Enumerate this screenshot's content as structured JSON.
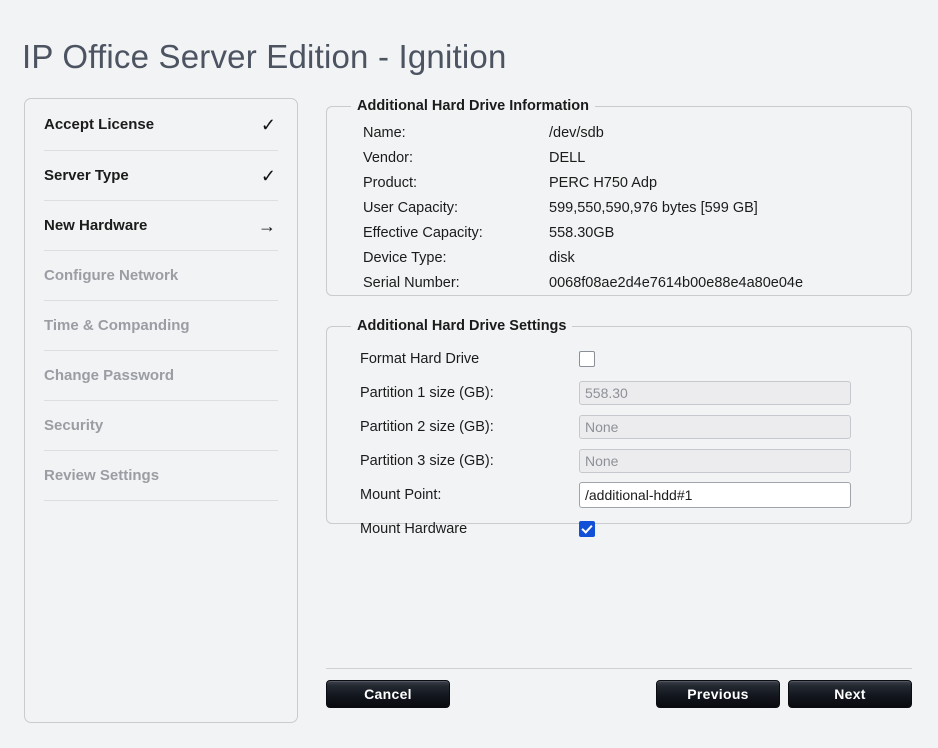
{
  "window": {
    "title": "IP Office Server Edition - Ignition"
  },
  "sidebar": {
    "items": [
      {
        "label": "Accept License",
        "state": "done",
        "mark": "✓"
      },
      {
        "label": "Server Type",
        "state": "done",
        "mark": "✓"
      },
      {
        "label": "New Hardware",
        "state": "current",
        "mark": "→"
      },
      {
        "label": "Configure Network",
        "state": "pending",
        "mark": ""
      },
      {
        "label": "Time & Companding",
        "state": "pending",
        "mark": ""
      },
      {
        "label": "Change Password",
        "state": "pending",
        "mark": ""
      },
      {
        "label": "Security",
        "state": "pending",
        "mark": ""
      },
      {
        "label": "Review Settings",
        "state": "pending",
        "mark": ""
      }
    ]
  },
  "info_panel": {
    "legend": "Additional Hard Drive Information",
    "rows": [
      {
        "label": "Name:",
        "value": "/dev/sdb"
      },
      {
        "label": "Vendor:",
        "value": "DELL"
      },
      {
        "label": "Product:",
        "value": "PERC H750 Adp"
      },
      {
        "label": "User Capacity:",
        "value": "599,550,590,976 bytes [599 GB]"
      },
      {
        "label": "Effective Capacity:",
        "value": "558.30GB"
      },
      {
        "label": "Device Type:",
        "value": "disk"
      },
      {
        "label": "Serial Number:",
        "value": "0068f08ae2d4e7614b00e88e4a80e04e"
      }
    ]
  },
  "settings_panel": {
    "legend": "Additional Hard Drive Settings",
    "format_hard_drive": {
      "label": "Format Hard Drive",
      "checked": false
    },
    "partition1": {
      "label": "Partition 1 size (GB):",
      "value": "",
      "placeholder": "558.30",
      "enabled": false
    },
    "partition2": {
      "label": "Partition 2 size (GB):",
      "value": "",
      "placeholder": "None",
      "enabled": false
    },
    "partition3": {
      "label": "Partition 3 size (GB):",
      "value": "",
      "placeholder": "None",
      "enabled": false
    },
    "mount_point": {
      "label": "Mount Point:",
      "value": "/additional-hdd#1",
      "enabled": true
    },
    "mount_hardware": {
      "label": "Mount Hardware",
      "checked": true
    }
  },
  "footer": {
    "cancel_label": "Cancel",
    "previous_label": "Previous",
    "next_label": "Next"
  },
  "colors": {
    "page_background": "#f2f3f4",
    "title_text": "#4c5361",
    "panel_border": "#c9cbcf",
    "checkbox_checked": "#1350d8",
    "disabled_text": "#8d9197",
    "pending_step_text": "#9a9da3"
  }
}
